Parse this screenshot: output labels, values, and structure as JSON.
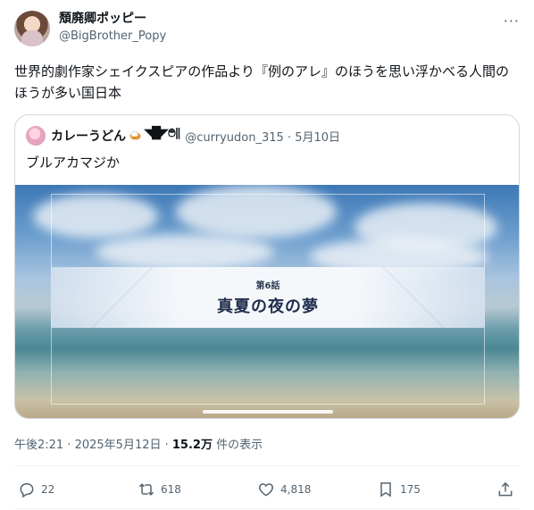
{
  "author": {
    "display_name": "頽廃卿ポッピー",
    "handle": "@BigBrother_Popy",
    "more_label": "···"
  },
  "tweet": {
    "text": "世界的劇作家シェイクスピアの作品より『例のアレ』のほうを思い浮かべる人間のほうが多い国日本"
  },
  "quote": {
    "display_name": "カレーうどん",
    "emoji": "🍛",
    "kaomoji": "◥█̆̈◤࿉∥",
    "handle_date": "@curryudon_315 · 5月10日",
    "text": "ブルアカマジか",
    "media": {
      "episode_label": "第6話",
      "episode_title": "真夏の夜の夢"
    }
  },
  "meta": {
    "timestamp": "午後2:21 · 2025年5月12日 · ",
    "views": "15.2万",
    "views_suffix": " 件の表示"
  },
  "actions": {
    "replies": "22",
    "reposts": "618",
    "likes": "4,818",
    "bookmarks": "175"
  }
}
